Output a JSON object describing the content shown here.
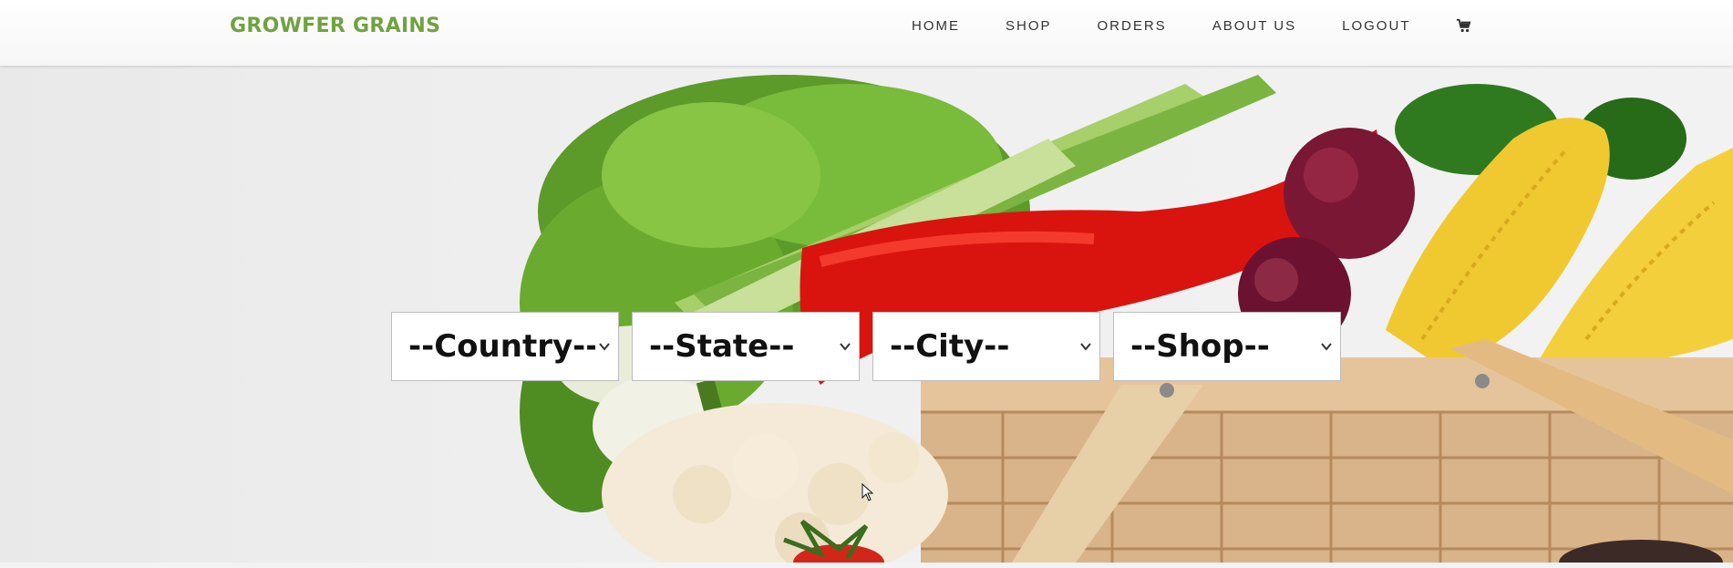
{
  "brand": {
    "name": "GROWFER GRAINS",
    "color": "#6fa33f"
  },
  "nav": {
    "items": [
      "HOME",
      "SHOP",
      "ORDERS",
      "ABOUT US",
      "LOGOUT"
    ],
    "cart_icon": "cart-icon"
  },
  "hero": {
    "background_image": "vegetables-basket-photo"
  },
  "filters": {
    "country": "--Country--",
    "state": "--State--",
    "city": "--City--",
    "shop": "--Shop--"
  }
}
